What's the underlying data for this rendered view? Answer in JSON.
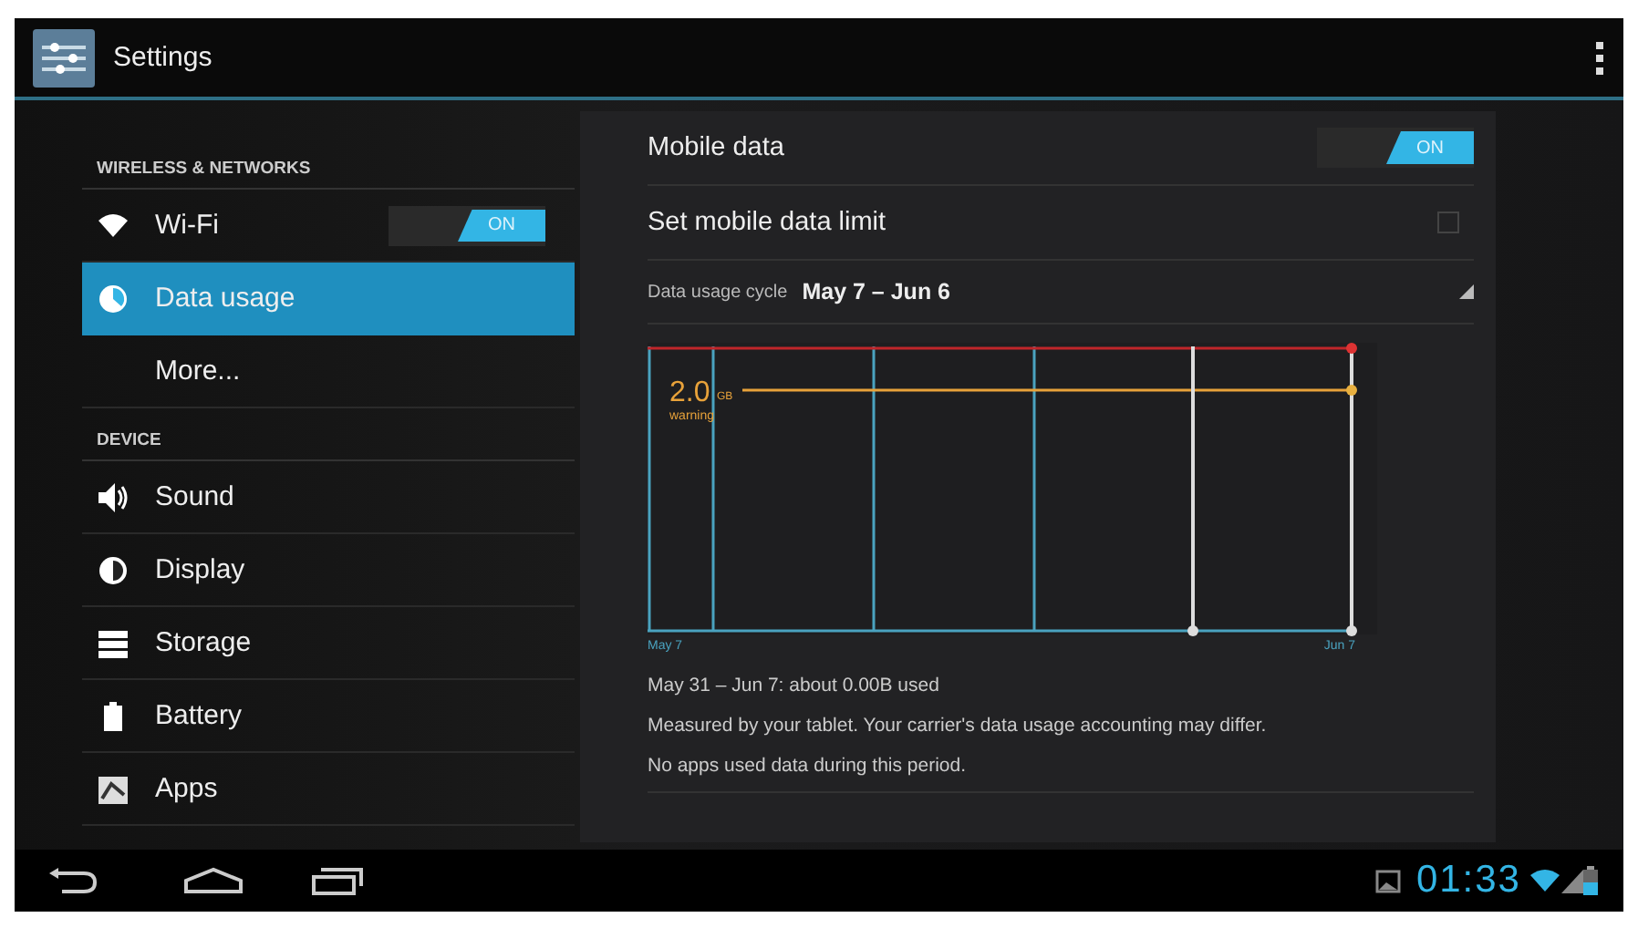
{
  "title_bar": {
    "title": "Settings"
  },
  "sidebar": {
    "sections": [
      {
        "header": "WIRELESS & NETWORKS",
        "items": [
          {
            "label": "Wi-Fi",
            "selected": false,
            "toggle": {
              "label": "ON",
              "on": true
            }
          },
          {
            "label": "Data usage",
            "selected": true
          },
          {
            "label": "More...",
            "selected": false
          }
        ]
      },
      {
        "header": "DEVICE",
        "items": [
          {
            "label": "Sound",
            "selected": false
          },
          {
            "label": "Display",
            "selected": false
          },
          {
            "label": "Storage",
            "selected": false
          },
          {
            "label": "Battery",
            "selected": false
          },
          {
            "label": "Apps",
            "selected": false
          }
        ]
      }
    ]
  },
  "detail": {
    "mobile_data": {
      "label": "Mobile data",
      "toggle": {
        "label": "ON",
        "on": true
      }
    },
    "data_limit": {
      "label": "Set mobile data limit",
      "checked": false
    },
    "cycle": {
      "label": "Data usage cycle",
      "value": "May 7 – Jun 6"
    },
    "chart": {
      "warning_value": "2.0",
      "warning_unit": "GB",
      "warning_label": "warning",
      "start_label": "May 7",
      "end_label": "Jun 7"
    },
    "summary": "May 31 – Jun 7: about 0.00B used",
    "notes": [
      "Measured by your tablet. Your carrier's data usage accounting may differ.",
      "No apps used data during this period."
    ]
  },
  "status_bar": {
    "time": "01:33"
  }
}
